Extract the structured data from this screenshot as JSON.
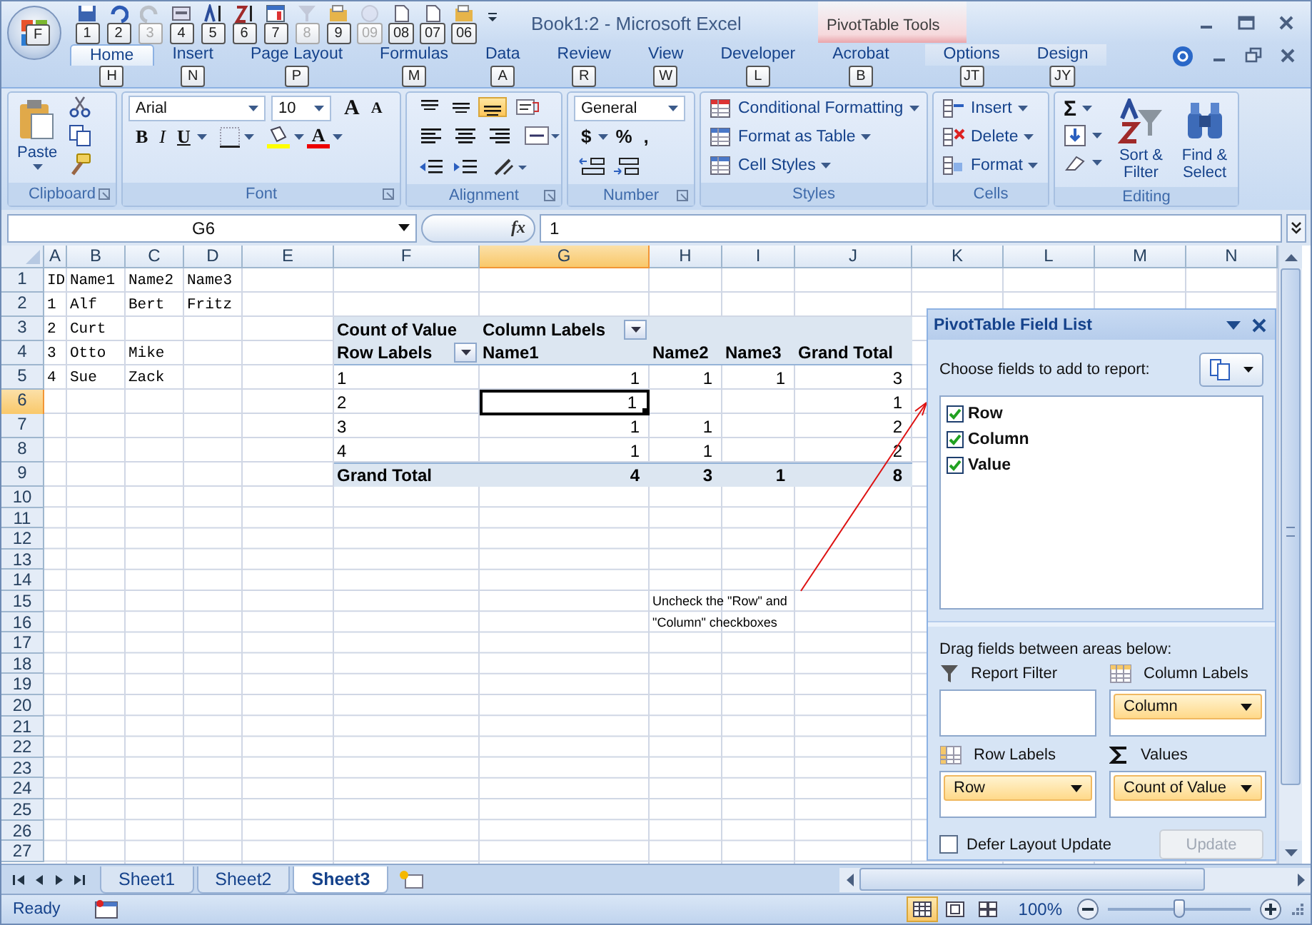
{
  "window": {
    "title": "Book1:2 - Microsoft Excel",
    "office_button_keytip": "F"
  },
  "quick_access": [
    {
      "kind": "save",
      "keytip": "1",
      "disabled": false
    },
    {
      "kind": "undo",
      "keytip": "2",
      "disabled": false
    },
    {
      "kind": "redo",
      "keytip": "3",
      "disabled": true
    },
    {
      "kind": "form",
      "keytip": "4",
      "disabled": false
    },
    {
      "kind": "sort-up",
      "keytip": "5",
      "disabled": false
    },
    {
      "kind": "sort-down",
      "keytip": "6",
      "disabled": false
    },
    {
      "kind": "chart",
      "keytip": "7",
      "disabled": false
    },
    {
      "kind": "filter",
      "keytip": "8",
      "disabled": true
    },
    {
      "kind": "folder",
      "keytip": "9",
      "disabled": false
    },
    {
      "kind": "circle",
      "keytip": "09",
      "disabled": true
    },
    {
      "kind": "page",
      "keytip": "08",
      "disabled": false
    },
    {
      "kind": "page",
      "keytip": "07",
      "disabled": false
    },
    {
      "kind": "folder",
      "keytip": "06",
      "disabled": false
    }
  ],
  "tabs": [
    {
      "label": "Home",
      "keytip": "H",
      "selected": true
    },
    {
      "label": "Insert",
      "keytip": "N",
      "selected": false
    },
    {
      "label": "Page Layout",
      "keytip": "P",
      "selected": false
    },
    {
      "label": "Formulas",
      "keytip": "M",
      "selected": false
    },
    {
      "label": "Data",
      "keytip": "A",
      "selected": false
    },
    {
      "label": "Review",
      "keytip": "R",
      "selected": false
    },
    {
      "label": "View",
      "keytip": "W",
      "selected": false
    },
    {
      "label": "Developer",
      "keytip": "L",
      "selected": false
    },
    {
      "label": "Acrobat",
      "keytip": "B",
      "selected": false
    }
  ],
  "contextual_group": {
    "title": "PivotTable Tools",
    "tabs": [
      {
        "label": "Options",
        "keytip": "JT",
        "selected": false
      },
      {
        "label": "Design",
        "keytip": "JY",
        "selected": false
      }
    ]
  },
  "ribbon": {
    "clipboard": {
      "label": "Clipboard",
      "paste": "Paste"
    },
    "font": {
      "label": "Font",
      "font_name": "Arial",
      "font_size": "10",
      "grow": "A",
      "shrink": "A",
      "bold": "B",
      "italic": "I",
      "underline": "U",
      "font_color": "A"
    },
    "alignment": {
      "label": "Alignment",
      "vertical_align": [
        {
          "selected": false
        },
        {
          "selected": false
        },
        {
          "selected": true
        }
      ]
    },
    "number": {
      "label": "Number",
      "format": "General",
      "currency": "$",
      "percent": "%",
      "comma": ","
    },
    "styles": {
      "label": "Styles",
      "items": [
        "Conditional Formatting",
        "Format as Table",
        "Cell Styles"
      ]
    },
    "cells": {
      "label": "Cells",
      "items": [
        "Insert",
        "Delete",
        "Format"
      ]
    },
    "editing": {
      "label": "Editing",
      "sum": "Σ",
      "sort": "Sort & Filter",
      "find": "Find & Select"
    }
  },
  "formula_bar": {
    "name_box": "G6",
    "fx": "fx",
    "value": "1"
  },
  "sheet": {
    "columns": [
      {
        "label": "A",
        "selected": false
      },
      {
        "label": "B",
        "selected": false
      },
      {
        "label": "C",
        "selected": false
      },
      {
        "label": "D",
        "selected": false
      },
      {
        "label": "E",
        "selected": false
      },
      {
        "label": "F",
        "selected": false
      },
      {
        "label": "G",
        "selected": true
      },
      {
        "label": "H",
        "selected": false
      },
      {
        "label": "I",
        "selected": false
      },
      {
        "label": "J",
        "selected": false
      },
      {
        "label": "K",
        "selected": false
      },
      {
        "label": "L",
        "selected": false
      },
      {
        "label": "M",
        "selected": false
      },
      {
        "label": "N",
        "selected": false
      }
    ],
    "rows": [
      {
        "label": "1",
        "selected": false
      },
      {
        "label": "2",
        "selected": false
      },
      {
        "label": "3",
        "selected": false
      },
      {
        "label": "4",
        "selected": false
      },
      {
        "label": "5",
        "selected": false
      },
      {
        "label": "6",
        "selected": true
      },
      {
        "label": "7",
        "selected": false
      },
      {
        "label": "8",
        "selected": false
      },
      {
        "label": "9",
        "selected": false
      },
      {
        "label": "10",
        "selected": false
      },
      {
        "label": "11",
        "selected": false
      },
      {
        "label": "12",
        "selected": false
      },
      {
        "label": "13",
        "selected": false
      },
      {
        "label": "14",
        "selected": false
      },
      {
        "label": "15",
        "selected": false
      },
      {
        "label": "16",
        "selected": false
      },
      {
        "label": "17",
        "selected": false
      },
      {
        "label": "18",
        "selected": false
      },
      {
        "label": "19",
        "selected": false
      },
      {
        "label": "20",
        "selected": false
      },
      {
        "label": "21",
        "selected": false
      },
      {
        "label": "22",
        "selected": false
      },
      {
        "label": "23",
        "selected": false
      },
      {
        "label": "24",
        "selected": false
      },
      {
        "label": "25",
        "selected": false
      },
      {
        "label": "26",
        "selected": false
      },
      {
        "label": "27",
        "selected": false
      }
    ]
  },
  "source_data": {
    "header": [
      "ID",
      "Name1",
      "Name2",
      "Name3"
    ],
    "rows": [
      [
        "1",
        "Alf",
        "Bert",
        "Fritz"
      ],
      [
        "2",
        "Curt"
      ],
      [
        "3",
        "Otto",
        "Mike"
      ],
      [
        "4",
        "Sue",
        "Zack"
      ]
    ]
  },
  "pivot_table": {
    "corner": "Count of Value",
    "column_labels": "Column Labels",
    "row_labels": "Row Labels",
    "columns": [
      "Name1",
      "Name2",
      "Name3",
      "Grand Total"
    ],
    "rows": [
      {
        "label": "1",
        "name1": "1",
        "name2": "1",
        "name3": "1",
        "grand_total": "3"
      },
      {
        "label": "2",
        "name1": "1",
        "grand_total": "1"
      },
      {
        "label": "3",
        "name1": "1",
        "name2": "1",
        "grand_total": "2"
      },
      {
        "label": "4",
        "name1": "1",
        "name2": "1",
        "grand_total": "2"
      }
    ],
    "total": {
      "label": "Grand Total",
      "values": [
        "4",
        "3",
        "1",
        "8"
      ]
    }
  },
  "annotation": {
    "lines": [
      "Uncheck the \"Row\" and",
      "\"Column\" checkboxes"
    ]
  },
  "field_list": {
    "title": "PivotTable Field List",
    "choose_label": "Choose fields to add to report:",
    "fields": [
      {
        "label": "Row",
        "checked": true
      },
      {
        "label": "Column",
        "checked": true
      },
      {
        "label": "Value",
        "checked": true
      }
    ],
    "drag_label": "Drag fields between areas below:",
    "areas": [
      {
        "kind": "filter",
        "label": "Report Filter"
      },
      {
        "kind": "columns",
        "label": "Column Labels",
        "items": [
          "Column"
        ]
      },
      {
        "kind": "rows",
        "label": "Row Labels",
        "items": [
          "Row"
        ]
      },
      {
        "kind": "values",
        "label": "Values",
        "items": [
          "Count of Value"
        ]
      }
    ],
    "defer": {
      "label": "Defer Layout Update",
      "checked": false
    },
    "update": {
      "label": "Update",
      "disabled": true
    }
  },
  "sheet_tabs": [
    {
      "label": "Sheet1",
      "selected": false
    },
    {
      "label": "Sheet2",
      "selected": false
    },
    {
      "label": "Sheet3",
      "selected": true
    }
  ],
  "status_bar": {
    "status": "Ready",
    "views": [
      {
        "kind": "normal",
        "selected": true
      },
      {
        "kind": "layout",
        "selected": false
      },
      {
        "kind": "break",
        "selected": false
      }
    ],
    "zoom": "100%",
    "zoom_slider": {
      "level": 0.5
    }
  }
}
